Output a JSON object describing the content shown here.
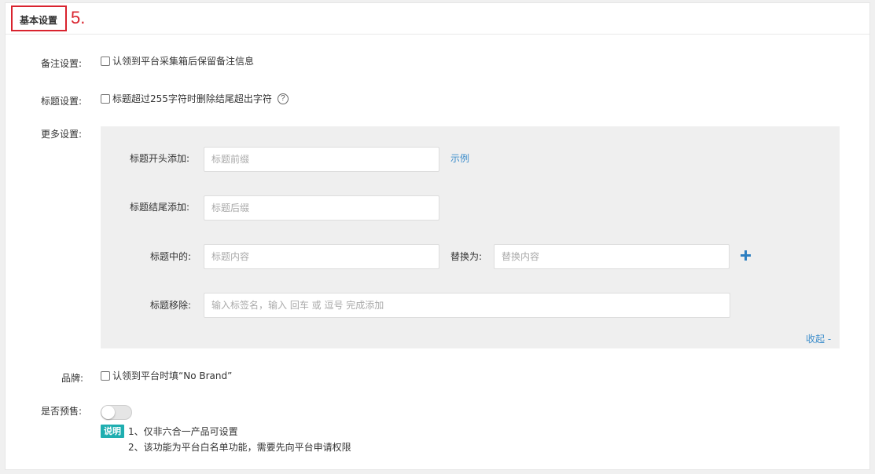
{
  "header": {
    "title": "基本设置",
    "step_annotation": "5."
  },
  "remark": {
    "label": "备注设置:",
    "checkbox_label": "认领到平台采集箱后保留备注信息",
    "checked": false
  },
  "title_setting": {
    "label": "标题设置:",
    "checkbox_label": "标题超过255字符时删除结尾超出字符",
    "checked": false,
    "help_glyph": "?"
  },
  "more": {
    "label": "更多设置:",
    "prefix": {
      "label": "标题开头添加:",
      "placeholder": "标题前缀",
      "example_link": "示例"
    },
    "suffix": {
      "label": "标题结尾添加:",
      "placeholder": "标题后缀"
    },
    "replace": {
      "label": "标题中的:",
      "placeholder": "标题内容",
      "replace_label": "替换为:",
      "replace_placeholder": "替换内容",
      "add_icon": "plus-icon"
    },
    "remove": {
      "label": "标题移除:",
      "placeholder": "输入标签名，输入 回车 或 逗号 完成添加"
    },
    "collapse_link": "收起 -"
  },
  "brand": {
    "label": "品牌:",
    "checkbox_label": "认领到平台时填“No Brand”",
    "checked": false
  },
  "presale": {
    "label": "是否预售:",
    "enabled": false,
    "note_badge": "说明",
    "notes": [
      "1、仅非六合一产品可设置",
      "2、该功能为平台白名单功能，需要先向平台申请权限"
    ]
  },
  "colors": {
    "highlight": "#d9232e",
    "link": "#3c8dcb",
    "badge": "#1faeb0",
    "plus": "#2d7fc1"
  }
}
